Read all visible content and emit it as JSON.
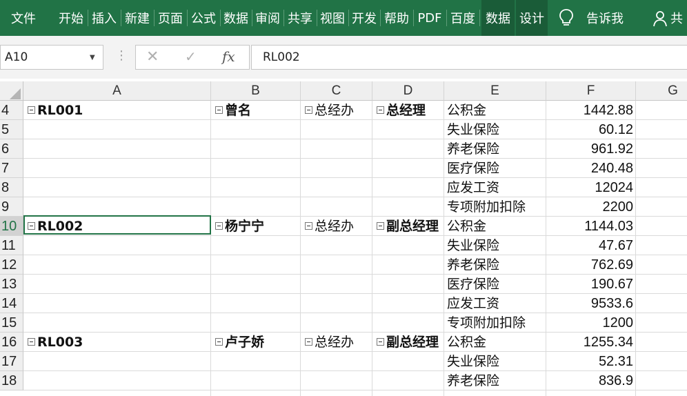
{
  "ribbon": {
    "tabs": [
      "文件",
      "开始",
      "插入",
      "新建",
      "页面",
      "公式",
      "数据",
      "审阅",
      "共享",
      "视图",
      "开发",
      "帮助",
      "PDF",
      "百度",
      "数据",
      "设计"
    ],
    "tell_me": "告诉我",
    "share": "共"
  },
  "formula_bar": {
    "name_box": "A10",
    "cancel_glyph": "✕",
    "enter_glyph": "✓",
    "fx_label": "fx",
    "formula_value": "RL002"
  },
  "columns": [
    "A",
    "B",
    "C",
    "D",
    "E",
    "F",
    "G"
  ],
  "rows": [
    {
      "num": "4",
      "a": "RL001",
      "b": "曾名",
      "c": "总经办",
      "d": "总经理",
      "e": "公积金",
      "f": "1442.88"
    },
    {
      "num": "5",
      "e": "失业保险",
      "f": "60.12"
    },
    {
      "num": "6",
      "e": "养老保险",
      "f": "961.92"
    },
    {
      "num": "7",
      "e": "医疗保险",
      "f": "240.48"
    },
    {
      "num": "8",
      "e": "应发工资",
      "f": "12024"
    },
    {
      "num": "9",
      "e": "专项附加扣除",
      "f": "2200"
    },
    {
      "num": "10",
      "a": "RL002",
      "b": "杨宁宁",
      "c": "总经办",
      "d": "副总经理",
      "e": "公积金",
      "f": "1144.03"
    },
    {
      "num": "11",
      "e": "失业保险",
      "f": "47.67"
    },
    {
      "num": "12",
      "e": "养老保险",
      "f": "762.69"
    },
    {
      "num": "13",
      "e": "医疗保险",
      "f": "190.67"
    },
    {
      "num": "14",
      "e": "应发工资",
      "f": "9533.6"
    },
    {
      "num": "15",
      "e": "专项附加扣除",
      "f": "1200"
    },
    {
      "num": "16",
      "a": "RL003",
      "b": "卢子娇",
      "c": "总经办",
      "d": "副总经理",
      "e": "公积金",
      "f": "1255.34"
    },
    {
      "num": "17",
      "e": "失业保险",
      "f": "52.31"
    },
    {
      "num": "18",
      "e": "养老保险",
      "f": "836.9"
    }
  ]
}
